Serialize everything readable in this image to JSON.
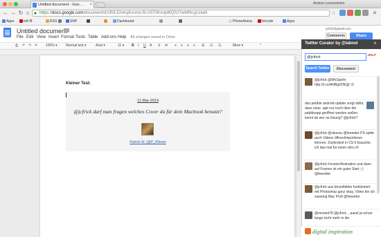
{
  "browser": {
    "tab_title": "Untitled document - Goo…",
    "url_scheme": "https://",
    "url_host": "docs.google.com",
    "url_path": "/document/d/1fhfL52vksjKvnnvrJ9-USTi9Uutp6fQS27wMf4cyjU/edit",
    "user_name": "Andore Lesezeichen",
    "bookmarks": [
      "Apps",
      "tuft f8",
      "RSS",
      "SNP",
      "Dashboard",
      "PhoneArena",
      "fe/code",
      "Apps"
    ]
  },
  "docs": {
    "title": "Untitled document",
    "menu": [
      "File",
      "Edit",
      "View",
      "Insert",
      "Format",
      "Tools",
      "Table",
      "Add-ons",
      "Help"
    ],
    "save_status": "All changes saved in Drive",
    "user_email": "jcfrick@gmail.com",
    "comments_label": "Comments",
    "share_label": "Share",
    "toolbar": {
      "zoom": "100%",
      "style": "Normal text",
      "font": "Arial",
      "size": "11",
      "more": "More"
    }
  },
  "document": {
    "heading": "Kleiner Test:",
    "tweet_date": "11-Mar-2014",
    "tweet_text": "@jcfrick darf man fragen welches Cover du für dein Macbook benutzt?",
    "tweet_author": "Patrick W. (@P_Wiener"
  },
  "sidebar": {
    "title": "Twitter Curator by @labnol",
    "search_value": "@jcfrick",
    "help_label": "HELP",
    "search_button": "Search Twitter",
    "disconnect_button": "Disconnect",
    "tweets": [
      "@jcfrick @MicSpehr http://t.co/ANBg02NQjI :D",
      "das pebble android update sorgt dafür, dass neue .apk nur noch über die pebbleapp geöffnet werden wollen. kennt da wer ne lösung? @jcfrick?",
      "@jcfrick @stiuvou @feeeider PS spitte auch Videos öffnen/importieren können. Zumindest in CS 6 brauchts ich das mal für einen citro.ch",
      "@jcfrick Fenster/Animation und dann auf Frames ist ein guter Start ;-) @feeeider",
      "@jcfrick aus Einzelbilder funktioniert mit Photoshop ganz okay, Video bin ich zuwenig Mac Profi @feeeider",
      "@mrwoid78 @jcfrick .. passt ja schon lange nicht mehr in die"
    ],
    "footer_logo": "digital inspiration"
  },
  "colors": {
    "accent": "#4d90fe",
    "docs_blue": "#4285f4",
    "sidebar_header": "#444444"
  }
}
